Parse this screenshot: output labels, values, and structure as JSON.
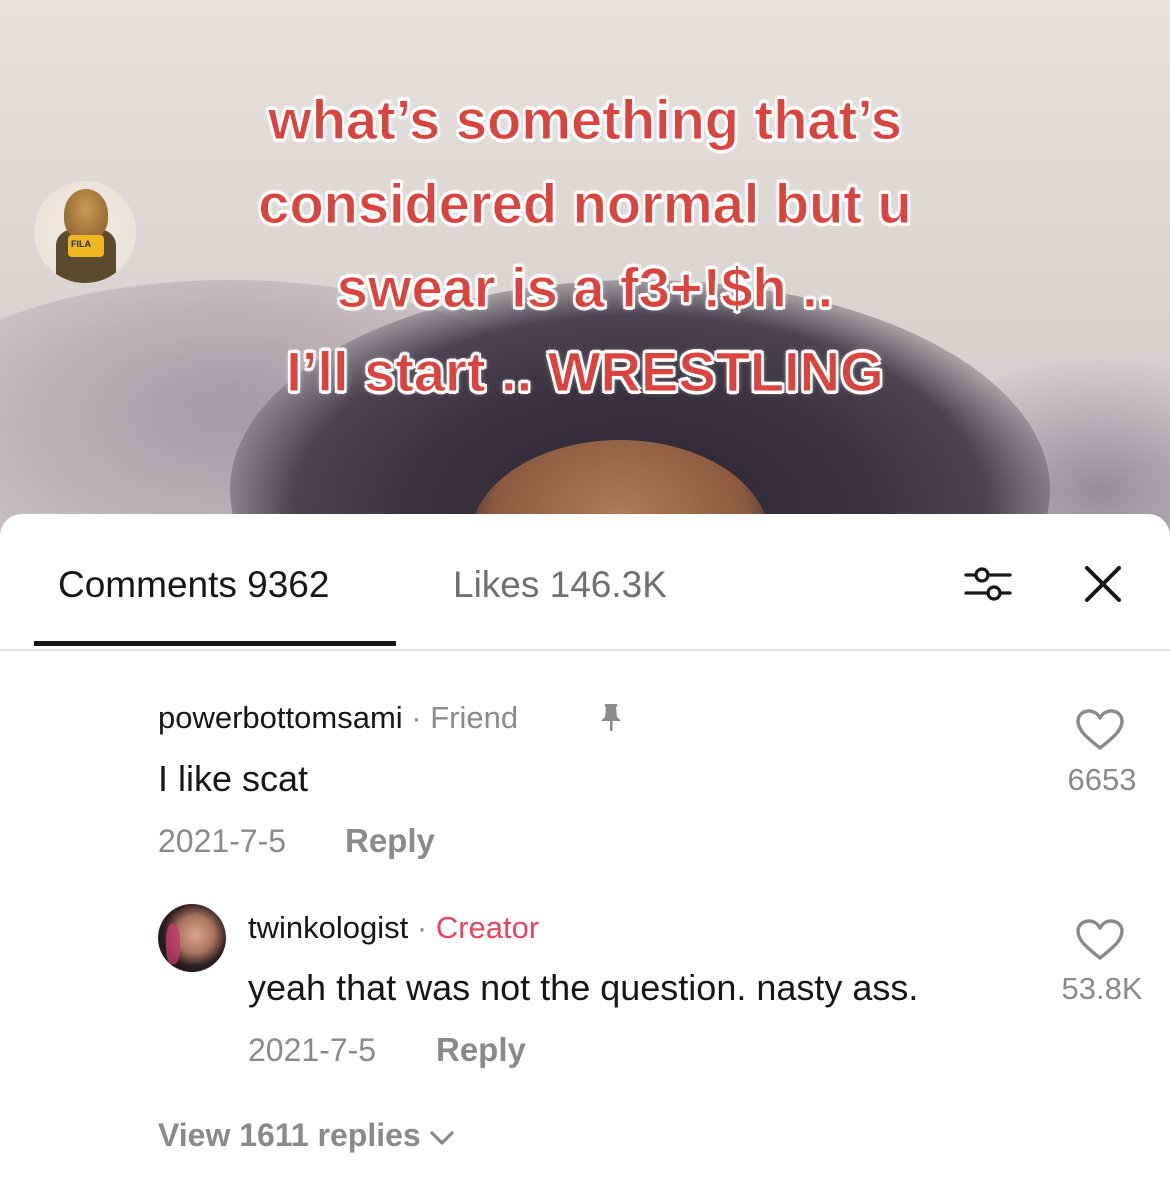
{
  "video": {
    "caption_lines": [
      "what’s something that’s",
      "considered normal but u",
      "swear is a f3+!$h ..",
      "I’ll start .. WRESTLING"
    ]
  },
  "panel": {
    "tabs": {
      "comments_label": "Comments 9362",
      "likes_label": "Likes 146.3K"
    },
    "filter_icon": "filter-sliders-icon",
    "close_icon": "close-icon"
  },
  "comments": [
    {
      "username": "powerbottomsami",
      "separator": "·",
      "badge": "Friend",
      "pinned_icon": "pin-icon",
      "text": "I like scat",
      "date": "2021-7-5",
      "reply_label": "Reply",
      "likes": "6653",
      "avatar_text": "FILA"
    },
    {
      "username": "twinkologist",
      "separator": "·",
      "badge": "Creator",
      "text": "yeah that was not the question. nasty ass.",
      "date": "2021-7-5",
      "reply_label": "Reply",
      "likes": "53.8K"
    }
  ],
  "view_replies": "View 1611 replies",
  "colors": {
    "caption_red": "#d9443f",
    "creator_badge": "#e4445d",
    "secondary_text": "#8a8a8a",
    "primary_text": "#161616"
  }
}
